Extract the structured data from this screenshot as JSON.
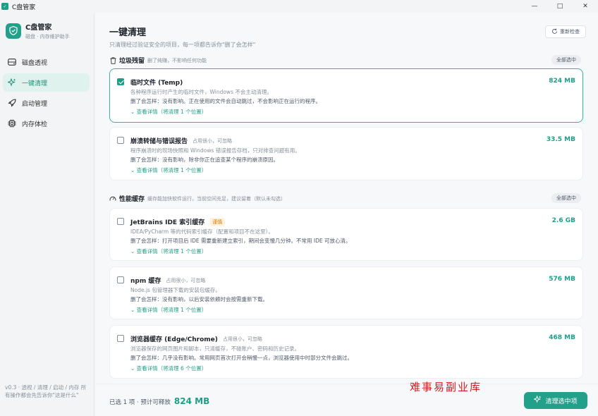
{
  "window": {
    "title": "C盘管家",
    "controls": [
      "—",
      "□",
      "✕"
    ]
  },
  "sidebar": {
    "brand_name": "C盘管家",
    "brand_sub": "磁盘 · 内存维护助手",
    "items": [
      {
        "label": "磁盘透视",
        "icon": "disk-icon"
      },
      {
        "label": "一键清理",
        "icon": "sparkle-icon",
        "active": true
      },
      {
        "label": "启动管理",
        "icon": "rocket-icon"
      },
      {
        "label": "内存体检",
        "icon": "chip-icon"
      }
    ],
    "footnote": "v0.3 · 透视 / 清理 / 启动 / 内存 所有操作都会先告诉你\"这是什么\""
  },
  "main": {
    "title": "一键清理",
    "subtitle": "只清理经过验证安全的项目，每一项都告诉你\"删了会怎样\"",
    "recheck_label": "重新检查",
    "sections": [
      {
        "title": "垃圾残留",
        "desc": "删了纯赚，不影响任何功能",
        "select_all": "全部选中"
      },
      {
        "title": "性能缓存",
        "desc": "缓存能加快软件运行，当前空间充足，建议留着（默认未勾选）",
        "select_all": "全部选中"
      }
    ],
    "items": [
      {
        "name": "临时文件 (Temp)",
        "tag": "",
        "size": "824 MB",
        "checked": true,
        "desc": "各种程序运行时产生的临时文件，Windows 不会主动清理。",
        "impact": "删了会怎样：没有影响。正在使用的文件会自动跳过，不会影响正在运行的程序。",
        "detail": "查看详情（将清理 1 个位置）"
      },
      {
        "name": "崩溃转储与错误报告",
        "tag": "占用很小，可忽略",
        "size": "33.5 MB",
        "checked": false,
        "desc": "程序崩溃时的现场快照和 Windows 错误报告存档，只对排查问题有用。",
        "impact": "删了会怎样：没有影响，除非你正在追查某个程序的崩溃原因。",
        "detail": "查看详情（将清理 1 个位置）"
      },
      {
        "name": "JetBrains IDE 索引缓存",
        "tag": "谨慎",
        "size": "2.6 GB",
        "checked": false,
        "desc": "IDEA/PyCharm 等的代码索引缓存（配置和项目不在这里）。",
        "impact": "删了会怎样：打开项目后 IDE 需要重新建立索引，期间会变慢几分钟。不常用 IDE 可放心清。",
        "detail": "查看详情（将清理 1 个位置）"
      },
      {
        "name": "npm 缓存",
        "tag": "占用很小，可忽略",
        "size": "576 MB",
        "checked": false,
        "desc": "Node.js 包管理器下载的安装包缓存。",
        "impact": "删了会怎样：没有影响，以后安装依赖时会按需重新下载。",
        "detail": "查看详情（将清理 1 个位置）"
      },
      {
        "name": "浏览器缓存 (Edge/Chrome)",
        "tag": "占用很小，可忽略",
        "size": "468 MB",
        "checked": false,
        "desc": "浏览器保存的网页图片和脚本，只清缓存，不碰账户、密码和历史记录。",
        "impact": "删了会怎样：几乎没有影响。常用网页首次打开会稍慢一点，浏览器使用中时部分文件会跳过。",
        "detail": "查看详情（将清理 6 个位置）"
      }
    ]
  },
  "bottom": {
    "summary_prefix": "已选 1 项 · 预计可释放",
    "summary_size": "824 MB",
    "clean_button": "清理选中项",
    "watermark": "难事易副业库"
  },
  "colors": {
    "accent": "#1f9e86",
    "warn": "#e07a00",
    "watermark": "#d21d1d"
  }
}
